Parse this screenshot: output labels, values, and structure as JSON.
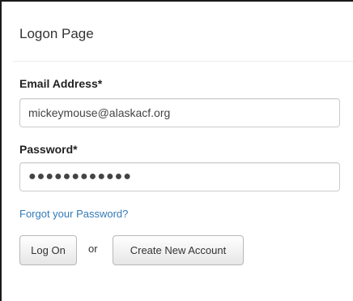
{
  "panel": {
    "heading": "Logon Page"
  },
  "form": {
    "email": {
      "label": "Email Address*",
      "value": "mickeymouse@alaskacf.org"
    },
    "password": {
      "label": "Password*",
      "value": "●●●●●●●●●●●●"
    },
    "forgot_link": "Forgot your Password?",
    "logon_button": "Log On",
    "or_text": "or",
    "create_account_button": "Create New Account"
  }
}
